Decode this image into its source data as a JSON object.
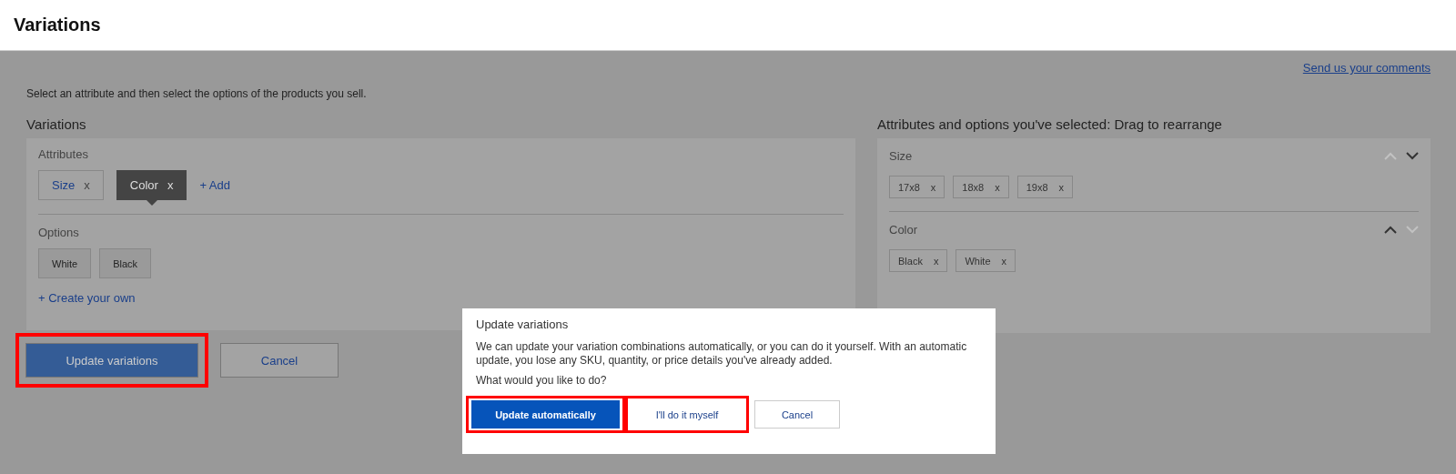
{
  "header": {
    "title": "Variations"
  },
  "feedback_link": "Send us your comments",
  "intro": "Select an attribute and then select the options of the products you sell.",
  "variations": {
    "heading": "Variations",
    "attributes_label": "Attributes",
    "attributes": [
      {
        "label": "Size",
        "remove": "x",
        "selected": false
      },
      {
        "label": "Color",
        "remove": "x",
        "selected": true
      }
    ],
    "add_link": "+ Add",
    "options_label": "Options",
    "options": [
      "White",
      "Black"
    ],
    "create_link": "+ Create your own"
  },
  "selected_panel": {
    "heading": "Attributes and options you've selected: Drag to rearrange",
    "groups": [
      {
        "name": "Size",
        "up_enabled": false,
        "down_enabled": true,
        "values": [
          {
            "label": "17x8",
            "remove": "x"
          },
          {
            "label": "18x8",
            "remove": "x"
          },
          {
            "label": "19x8",
            "remove": "x"
          }
        ]
      },
      {
        "name": "Color",
        "up_enabled": true,
        "down_enabled": false,
        "values": [
          {
            "label": "Black",
            "remove": "x"
          },
          {
            "label": "White",
            "remove": "x"
          }
        ]
      }
    ]
  },
  "actions": [
    {
      "label": "Update variations",
      "kind": "primary",
      "highlighted": true
    },
    {
      "label": "Cancel",
      "kind": "secondary",
      "highlighted": false
    }
  ],
  "dialog": {
    "title": "Update variations",
    "message": "We can update your variation combinations automatically, or you can do it yourself. With an automatic update, you lose any SKU, quantity, or price details you've already added.",
    "question": "What would you like to do?",
    "buttons": [
      {
        "label": "Update automatically",
        "kind": "primary",
        "highlighted": true
      },
      {
        "label": "I'll do it myself",
        "kind": "link",
        "highlighted": true
      },
      {
        "label": "Cancel",
        "kind": "secondary",
        "highlighted": false
      }
    ]
  }
}
